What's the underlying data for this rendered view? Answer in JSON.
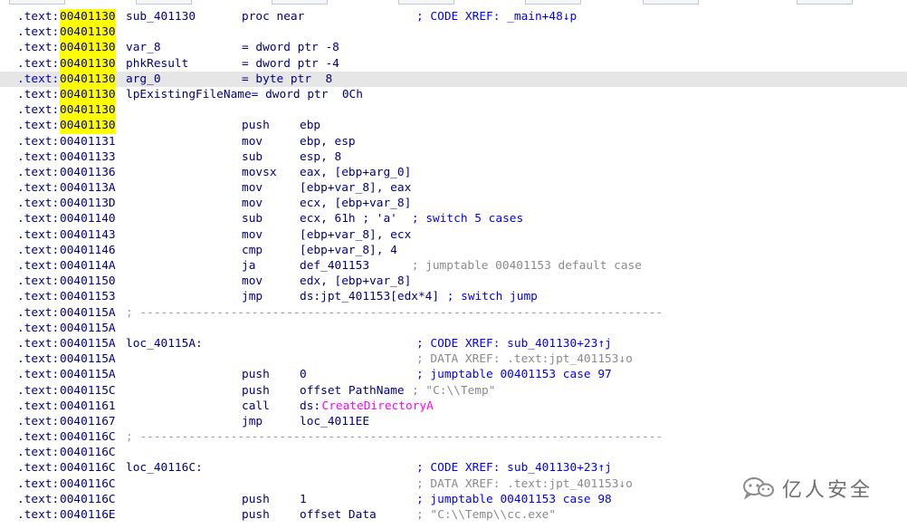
{
  "listing": {
    "lines": [
      {
        "seg": ".text:",
        "addr": "00401130",
        "hl": true,
        "label": "sub_401130",
        "mnem": "proc near",
        "operands": "",
        "comment": "; CODE XREF: _main+48↓p",
        "cstyle": "code"
      },
      {
        "seg": ".text:",
        "addr": "00401130",
        "hl": true,
        "label": "",
        "mnem": "",
        "operands": "",
        "comment": "",
        "cstyle": "code"
      },
      {
        "seg": ".text:",
        "addr": "00401130",
        "hl": true,
        "label": "var_8",
        "mnem": "= dword ptr -8",
        "operands": "",
        "comment": "",
        "cstyle": "code"
      },
      {
        "seg": ".text:",
        "addr": "00401130",
        "hl": true,
        "label": "phkResult",
        "mnem": "= dword ptr -4",
        "operands": "",
        "comment": "",
        "cstyle": "code"
      },
      {
        "seg": ".text:",
        "addr": "00401130",
        "hl": true,
        "label": "arg_0",
        "mnem": "= byte ptr  8",
        "operands": "",
        "comment": "",
        "cstyle": "code",
        "selected": true
      },
      {
        "seg": ".text:",
        "addr": "00401130",
        "hl": true,
        "label": "lpExistingFileName= dword ptr  0Ch",
        "mnem": "",
        "operands": "",
        "comment": "",
        "cstyle": "code"
      },
      {
        "seg": ".text:",
        "addr": "00401130",
        "hl": true,
        "label": "",
        "mnem": "",
        "operands": "",
        "comment": "",
        "cstyle": "code"
      },
      {
        "seg": ".text:",
        "addr": "00401130",
        "hl": true,
        "label": "",
        "mnem": "push",
        "operands": "ebp",
        "comment": "",
        "cstyle": "code"
      },
      {
        "seg": ".text:",
        "addr": "00401131",
        "hl": false,
        "label": "",
        "mnem": "mov",
        "operands": "ebp, esp",
        "comment": "",
        "cstyle": "code"
      },
      {
        "seg": ".text:",
        "addr": "00401133",
        "hl": false,
        "label": "",
        "mnem": "sub",
        "operands": "esp, 8",
        "comment": "",
        "cstyle": "code"
      },
      {
        "seg": ".text:",
        "addr": "00401136",
        "hl": false,
        "label": "",
        "mnem": "movsx",
        "operands": "eax, [ebp+arg_0]",
        "comment": "",
        "cstyle": "code"
      },
      {
        "seg": ".text:",
        "addr": "0040113A",
        "hl": false,
        "label": "",
        "mnem": "mov",
        "operands": "[ebp+var_8], eax",
        "comment": "",
        "cstyle": "code"
      },
      {
        "seg": ".text:",
        "addr": "0040113D",
        "hl": false,
        "label": "",
        "mnem": "mov",
        "operands": "ecx, [ebp+var_8]",
        "comment": "",
        "cstyle": "code"
      },
      {
        "seg": ".text:",
        "addr": "00401140",
        "hl": false,
        "label": "",
        "mnem": "sub",
        "operands": "ecx, 61h ; 'a'",
        "comment": "  ; switch 5 cases",
        "cstyle": "code"
      },
      {
        "seg": ".text:",
        "addr": "00401143",
        "hl": false,
        "label": "",
        "mnem": "mov",
        "operands": "[ebp+var_8], ecx",
        "comment": "",
        "cstyle": "code"
      },
      {
        "seg": ".text:",
        "addr": "00401146",
        "hl": false,
        "label": "",
        "mnem": "cmp",
        "operands": "[ebp+var_8], 4",
        "comment": "",
        "cstyle": "code"
      },
      {
        "seg": ".text:",
        "addr": "0040114A",
        "hl": false,
        "label": "",
        "mnem": "ja",
        "operands": "def_401153",
        "comment": "      ; jumptable 00401153 default case",
        "cstyle": "dim"
      },
      {
        "seg": ".text:",
        "addr": "00401150",
        "hl": false,
        "label": "",
        "mnem": "mov",
        "operands": "edx, [ebp+var_8]",
        "comment": "",
        "cstyle": "code"
      },
      {
        "seg": ".text:",
        "addr": "00401153",
        "hl": false,
        "label": "",
        "mnem": "jmp",
        "operands": "ds:jpt_401153[edx*4]",
        "comment": " ; switch jump",
        "cstyle": "code"
      },
      {
        "seg": ".text:",
        "addr": "0040115A",
        "hl": false,
        "label": "; ---------------------------------------------------------------------------",
        "mnem": "",
        "operands": "",
        "comment": "",
        "cstyle": "sep"
      },
      {
        "seg": ".text:",
        "addr": "0040115A",
        "hl": false,
        "label": "",
        "mnem": "",
        "operands": "",
        "comment": "",
        "cstyle": "code"
      },
      {
        "seg": ".text:",
        "addr": "0040115A",
        "hl": false,
        "label": "loc_40115A:",
        "mnem": "",
        "operands": "",
        "comment": "; CODE XREF: sub_401130+23↑j",
        "cstyle": "code"
      },
      {
        "seg": ".text:",
        "addr": "0040115A",
        "hl": false,
        "label": "",
        "mnem": "",
        "operands": "",
        "comment": "; DATA XREF: .text:jpt_401153↓o",
        "cstyle": "dim"
      },
      {
        "seg": ".text:",
        "addr": "0040115A",
        "hl": false,
        "label": "",
        "mnem": "push",
        "operands": "0",
        "comment": "; jumptable 00401153 case 97",
        "cstyle": "code"
      },
      {
        "seg": ".text:",
        "addr": "0040115C",
        "hl": false,
        "label": "",
        "mnem": "push",
        "operands": "offset PathName",
        "comment": " ; \"C:\\\\Temp\"",
        "cstyle": "dim"
      },
      {
        "seg": ".text:",
        "addr": "00401161",
        "hl": false,
        "label": "",
        "mnem": "call",
        "operands": "ds:",
        "fname": "CreateDirectoryA",
        "comment": "",
        "cstyle": "code"
      },
      {
        "seg": ".text:",
        "addr": "00401167",
        "hl": false,
        "label": "",
        "mnem": "jmp",
        "operands": "loc_4011EE",
        "comment": "",
        "cstyle": "code"
      },
      {
        "seg": ".text:",
        "addr": "0040116C",
        "hl": false,
        "label": "; ---------------------------------------------------------------------------",
        "mnem": "",
        "operands": "",
        "comment": "",
        "cstyle": "sep"
      },
      {
        "seg": ".text:",
        "addr": "0040116C",
        "hl": false,
        "label": "",
        "mnem": "",
        "operands": "",
        "comment": "",
        "cstyle": "code"
      },
      {
        "seg": ".text:",
        "addr": "0040116C",
        "hl": false,
        "label": "loc_40116C:",
        "mnem": "",
        "operands": "",
        "comment": "; CODE XREF: sub_401130+23↑j",
        "cstyle": "code"
      },
      {
        "seg": ".text:",
        "addr": "0040116C",
        "hl": false,
        "label": "",
        "mnem": "",
        "operands": "",
        "comment": "; DATA XREF: .text:jpt_401153↓o",
        "cstyle": "dim"
      },
      {
        "seg": ".text:",
        "addr": "0040116C",
        "hl": false,
        "label": "",
        "mnem": "push",
        "operands": "1",
        "comment": "; jumptable 00401153 case 98",
        "cstyle": "code"
      },
      {
        "seg": ".text:",
        "addr": "0040116E",
        "hl": false,
        "label": "",
        "mnem": "push",
        "operands": "offset Data",
        "comment": "; \"C:\\\\Temp\\\\cc.exe\"",
        "cstyle": "dim"
      }
    ]
  },
  "watermark": {
    "text": "亿人安全",
    "icon": "wechat-icon"
  }
}
